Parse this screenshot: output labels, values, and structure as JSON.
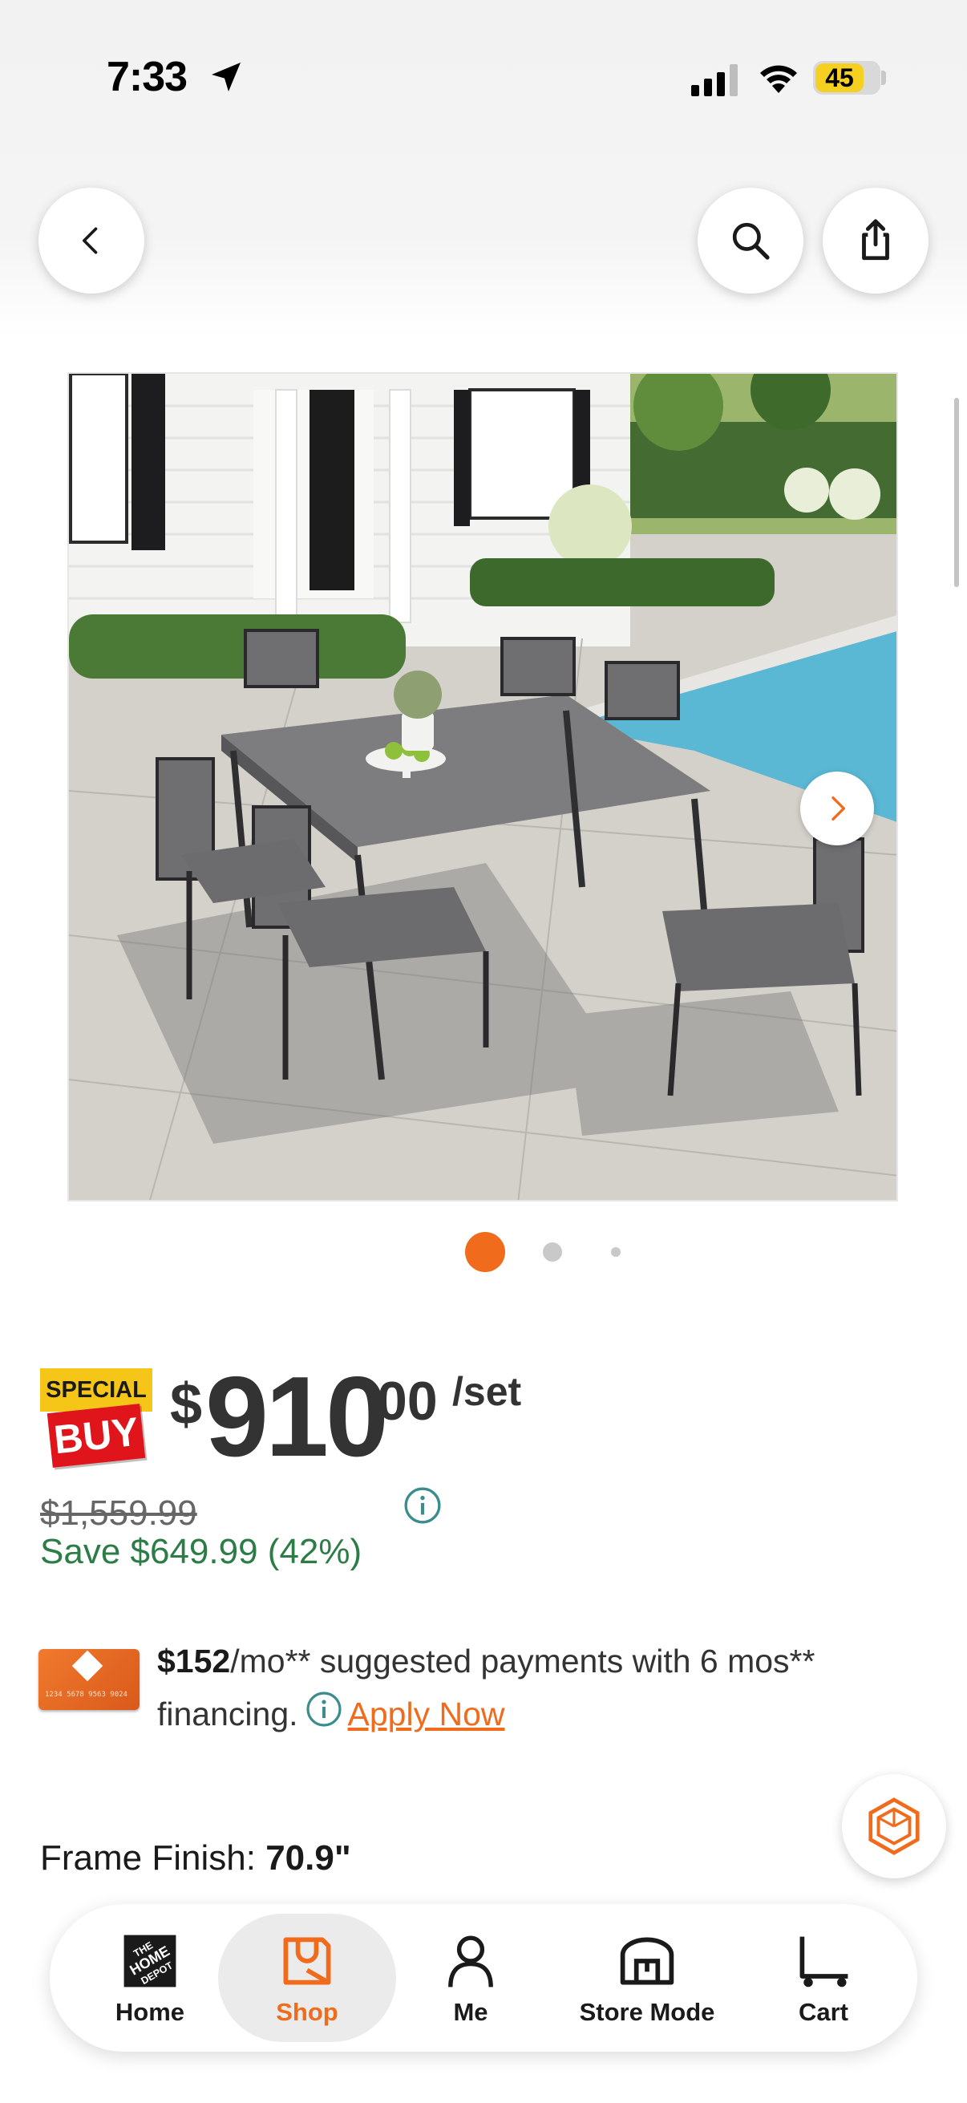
{
  "status_bar": {
    "time": "7:33",
    "battery": "45"
  },
  "nav": {
    "back": "chevron-left-icon",
    "search": "search-icon",
    "share": "share-icon"
  },
  "gallery": {
    "image_alt": "Outdoor patio dining set with gray slat table and six chairs beside a pool",
    "dot_count": 3,
    "active_dot": 1
  },
  "price": {
    "badge_top": "SPECIAL",
    "badge_bottom": "BUY",
    "currency": "$",
    "dollars": "910",
    "cents": "00",
    "unit": "/set",
    "was": "$1,559.99",
    "save": "Save $649.99 (42%)"
  },
  "financing": {
    "amount": "$152",
    "text": "/mo** suggested payments with 6 mos** financing.",
    "apply": "Apply Now",
    "card_number": "1234 5678 9563 9024"
  },
  "option": {
    "label": "Frame Finish:",
    "value": "70.9\""
  },
  "tabs": [
    {
      "label": "Home",
      "icon": "home-depot-logo-icon"
    },
    {
      "label": "Shop",
      "icon": "shop-icon",
      "active": true
    },
    {
      "label": "Me",
      "icon": "person-icon"
    },
    {
      "label": "Store Mode",
      "icon": "store-icon"
    },
    {
      "label": "Cart",
      "icon": "cart-icon"
    }
  ],
  "colors": {
    "accent": "#f06b1b",
    "save_green": "#2c7d45",
    "special_yellow": "#f5c518",
    "buy_red": "#e0151b"
  }
}
